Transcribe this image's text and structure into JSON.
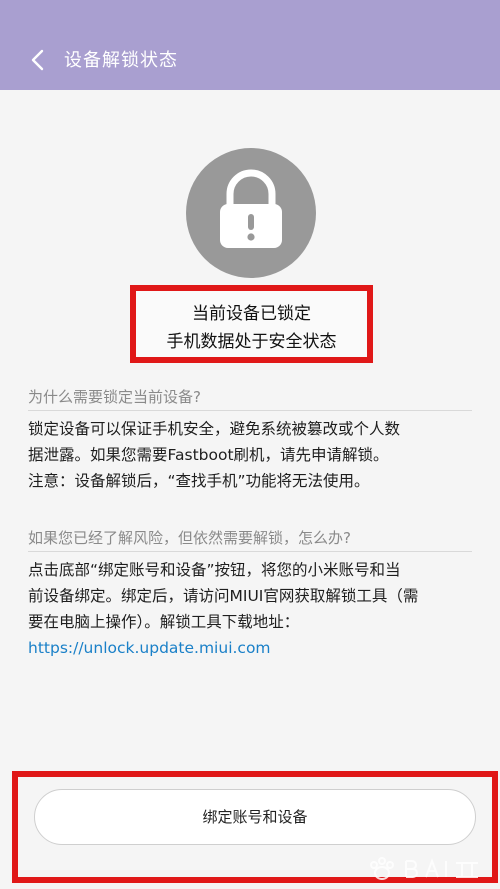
{
  "header": {
    "title": "设备解锁状态",
    "back_icon": "chevron-left-icon",
    "background": "#a99fd0"
  },
  "lock": {
    "icon": "padlock-icon",
    "color": "#999999"
  },
  "status": {
    "line1": "当前设备已锁定",
    "line2": "手机数据处于安全状态"
  },
  "section1": {
    "title": "为什么需要锁定当前设备?",
    "lines": [
      "锁定设备可以保证手机安全，避免系统被篡改或个人数",
      "据泄露。如果您需要Fastboot刷机，请先申请解锁。",
      "注意：设备解锁后，“查找手机”功能将无法使用。"
    ]
  },
  "section2": {
    "title": "如果您已经了解风险，但依然需要解锁，怎么办?",
    "lines": [
      "点击底部“绑定账号和设备”按钮，将您的小米账号和当",
      "前设备绑定。绑定后，请访问MIUI官网获取解锁工具（需",
      "要在电脑上操作）。解锁工具下载地址："
    ],
    "link": "https://unlock.update.miui.com"
  },
  "footer": {
    "button_label": "绑定账号和设备"
  },
  "colors": {
    "highlight": "#e01818",
    "link": "#1a80c8"
  }
}
